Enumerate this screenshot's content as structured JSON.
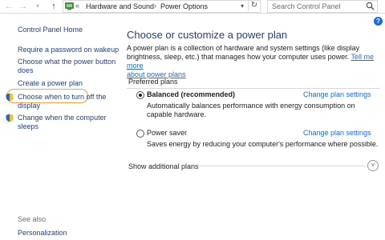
{
  "address": {
    "back_icon": "←",
    "forward_icon": "→",
    "recent_icon": "▾",
    "up_icon": "↑",
    "overflow": "«",
    "crumb1": "Hardware and Sound",
    "sep": "›",
    "crumb2": "Power Options",
    "dropdown": "▾",
    "refresh": "↻",
    "search_placeholder": "Search Control Panel"
  },
  "help": {
    "label": "?"
  },
  "sidebar": {
    "home": "Control Panel Home",
    "items": [
      {
        "label_line1": "Require a password on wakeup",
        "label_line2": ""
      },
      {
        "label_line1": "Choose what the power button",
        "label_line2": "does"
      },
      {
        "label_line1": "Create a power plan",
        "label_line2": ""
      },
      {
        "label_line1": "Choose when to turn off the",
        "label_line2": "display"
      },
      {
        "label_line1": "Change when the computer",
        "label_line2": "sleeps"
      }
    ],
    "see_also": "See also",
    "personalization": "Personalization"
  },
  "main": {
    "title": "Choose or customize a power plan",
    "intro_line1": "A power plan is a collection of hardware and system settings (like display",
    "intro_line2_text": "brightness, sleep, etc.) that manages how your computer uses power.",
    "intro_link1": "Tell me more",
    "intro_link2": "about power plans",
    "preferred_label": "Preferred plans",
    "plans": [
      {
        "name": "Balanced (recommended)",
        "selected": true,
        "change_label": "Change plan settings",
        "desc_line1": "Automatically balances performance with energy consumption on",
        "desc_line2": "capable hardware."
      },
      {
        "name": "Power saver",
        "selected": false,
        "change_label": "Change plan settings",
        "desc_line1": "Saves energy by reducing your computer's performance where possible.",
        "desc_line2": ""
      }
    ],
    "show_additional": "Show additional plans",
    "expand_icon": "v"
  },
  "colors": {
    "link": "#1c6ad6",
    "nav_link": "#1e3f87",
    "highlight": "#f0a13c"
  }
}
